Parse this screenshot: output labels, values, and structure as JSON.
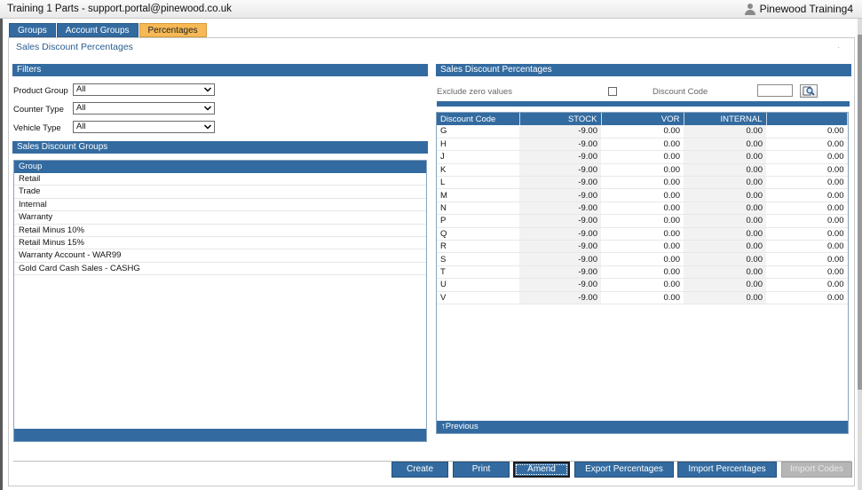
{
  "window": {
    "title": "Training 1 Parts - support.portal@pinewood.co.uk",
    "user": "Pinewood Training4"
  },
  "tabs": [
    {
      "label": "Groups",
      "active": false
    },
    {
      "label": "Account Groups",
      "active": false
    },
    {
      "label": "Percentages",
      "active": true
    }
  ],
  "page_title": "Sales Discount Percentages",
  "filters": {
    "heading": "Filters",
    "product_group": {
      "label": "Product Group",
      "value": "All"
    },
    "counter_type": {
      "label": "Counter Type",
      "value": "All"
    },
    "vehicle_type": {
      "label": "Vehicle Type",
      "value": "All"
    }
  },
  "groups": {
    "heading": "Sales Discount Groups",
    "column": "Group",
    "items": [
      "Retail",
      "Trade",
      "Internal",
      "Warranty",
      "Retail Minus 10%",
      "Retail Minus 15%",
      "Warranty Account - WAR99",
      "Gold Card Cash Sales - CASHG"
    ]
  },
  "percentages": {
    "heading": "Sales Discount Percentages",
    "exclude_zero_label": "Exclude zero values",
    "exclude_zero_checked": false,
    "discount_code_label": "Discount Code",
    "discount_code_value": "",
    "columns": [
      "Discount Code",
      "STOCK",
      "VOR",
      "INTERNAL",
      ""
    ],
    "rows": [
      [
        "G",
        "-9.00",
        "0.00",
        "0.00",
        "0.00"
      ],
      [
        "H",
        "-9.00",
        "0.00",
        "0.00",
        "0.00"
      ],
      [
        "J",
        "-9.00",
        "0.00",
        "0.00",
        "0.00"
      ],
      [
        "K",
        "-9.00",
        "0.00",
        "0.00",
        "0.00"
      ],
      [
        "L",
        "-9.00",
        "0.00",
        "0.00",
        "0.00"
      ],
      [
        "M",
        "-9.00",
        "0.00",
        "0.00",
        "0.00"
      ],
      [
        "N",
        "-9.00",
        "0.00",
        "0.00",
        "0.00"
      ],
      [
        "P",
        "-9.00",
        "0.00",
        "0.00",
        "0.00"
      ],
      [
        "Q",
        "-9.00",
        "0.00",
        "0.00",
        "0.00"
      ],
      [
        "R",
        "-9.00",
        "0.00",
        "0.00",
        "0.00"
      ],
      [
        "S",
        "-9.00",
        "0.00",
        "0.00",
        "0.00"
      ],
      [
        "T",
        "-9.00",
        "0.00",
        "0.00",
        "0.00"
      ],
      [
        "U",
        "-9.00",
        "0.00",
        "0.00",
        "0.00"
      ],
      [
        "V",
        "-9.00",
        "0.00",
        "0.00",
        "0.00"
      ]
    ],
    "previous_label": "↑Previous"
  },
  "buttons": {
    "create": "Create",
    "print": "Print",
    "amend": "Amend",
    "export": "Export Percentages",
    "import": "Import Percentages",
    "import_codes": "Import Codes"
  },
  "icons": {
    "user": "user-icon",
    "search": "search-icon",
    "dropdown": "chevron-down-icon"
  }
}
